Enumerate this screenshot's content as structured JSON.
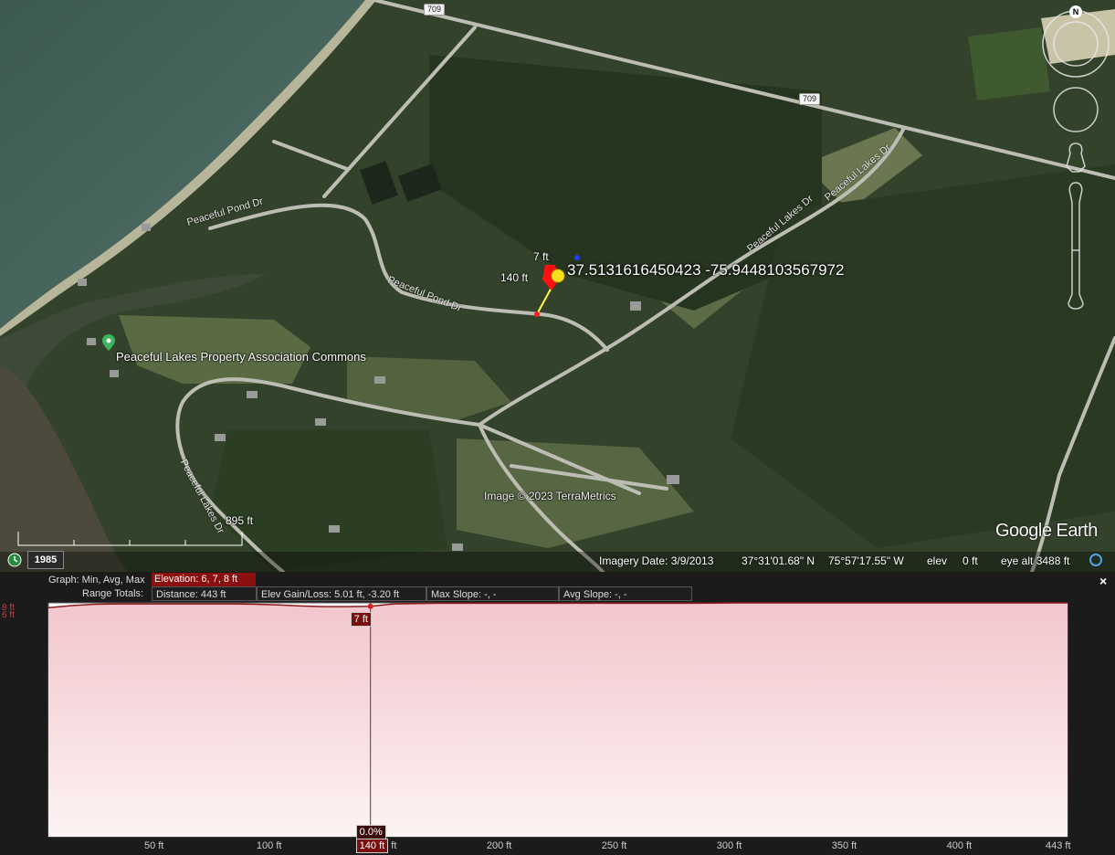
{
  "map": {
    "place_label": "Peaceful Lakes Property Association Commons",
    "roads": {
      "peaceful_pond_dr_1": "Peaceful Pond Dr",
      "peaceful_pond_dr_2": "Peaceful Pond Dr",
      "peaceful_lakes_dr_1": "Peaceful Lakes Dr",
      "peaceful_lakes_dr_2": "Peaceful Lakes Dr",
      "peaceful_lakes_dr_3": "Peaceful Lakes Dr",
      "route_1": "709",
      "route_2": "709"
    },
    "marker_top_label": "7 ft",
    "marker_side_label": "140 ft",
    "coordinates_text": "37.5131616450423 -75.9448103567972",
    "scale_label": "895 ft",
    "attribution": "Image © 2023 TerraMetrics",
    "logo": "Google Earth",
    "compass_letter": "N"
  },
  "status": {
    "historical_year": "1985",
    "imagery_date": "Imagery Date: 3/9/2013",
    "lat": "37°31'01.68\" N",
    "lon": "75°57'17.55\" W",
    "elev_label": "elev",
    "elev_value": "0 ft",
    "eye_alt": "eye alt 3488 ft"
  },
  "profile": {
    "graph_label": "Graph:  Min, Avg, Max",
    "elevation_summary": "Elevation: 6, 7, 8 ft",
    "range_totals_label": "Range Totals:",
    "distance": "Distance: 443 ft",
    "elev_gain_loss": "Elev Gain/Loss: 5.01 ft, -3.20 ft",
    "max_slope": "Max Slope: -, -",
    "avg_slope": "Avg Slope: -, -",
    "close_label": "×",
    "cursor_elevation": "7 ft",
    "cursor_slope": "0.0%",
    "cursor_distance": "140 ft",
    "x_ticks": [
      "50 ft",
      "100 ft",
      "150 ft",
      "200 ft",
      "250 ft",
      "300 ft",
      "350 ft",
      "400 ft",
      "443 ft"
    ],
    "y_ticks": [
      "8 ft",
      "6 ft"
    ],
    "colors": {
      "profile_line": "#8b1a1a",
      "fill_top": "#f2c6cc",
      "fill_bottom": "#fdf3f4",
      "flag": "#7a0f0f"
    }
  },
  "chart_data": {
    "type": "area",
    "xlabel": "",
    "ylabel": "",
    "x": [
      0,
      10,
      20,
      30,
      40,
      50,
      60,
      70,
      80,
      90,
      100,
      110,
      120,
      130,
      140,
      150,
      160,
      170,
      180,
      190,
      200,
      220,
      240,
      260,
      280,
      300,
      320,
      340,
      360,
      380,
      400,
      420,
      443
    ],
    "series": [
      {
        "values": [
          6.6,
          7.2,
          7.6,
          7.7,
          7.7,
          7.7,
          7.7,
          7.7,
          7.7,
          7.6,
          7.4,
          7.1,
          6.9,
          6.9,
          7.0,
          7.7,
          7.8,
          7.9,
          7.9,
          7.9,
          7.9,
          7.9,
          7.9,
          7.9,
          7.9,
          8.0,
          8.0,
          8.0,
          8.0,
          8.0,
          8.0,
          8.0,
          8.0
        ]
      }
    ],
    "xlim": [
      0,
      443
    ],
    "ylim": [
      -60,
      8
    ],
    "cursor_x": 140,
    "grid": true
  }
}
